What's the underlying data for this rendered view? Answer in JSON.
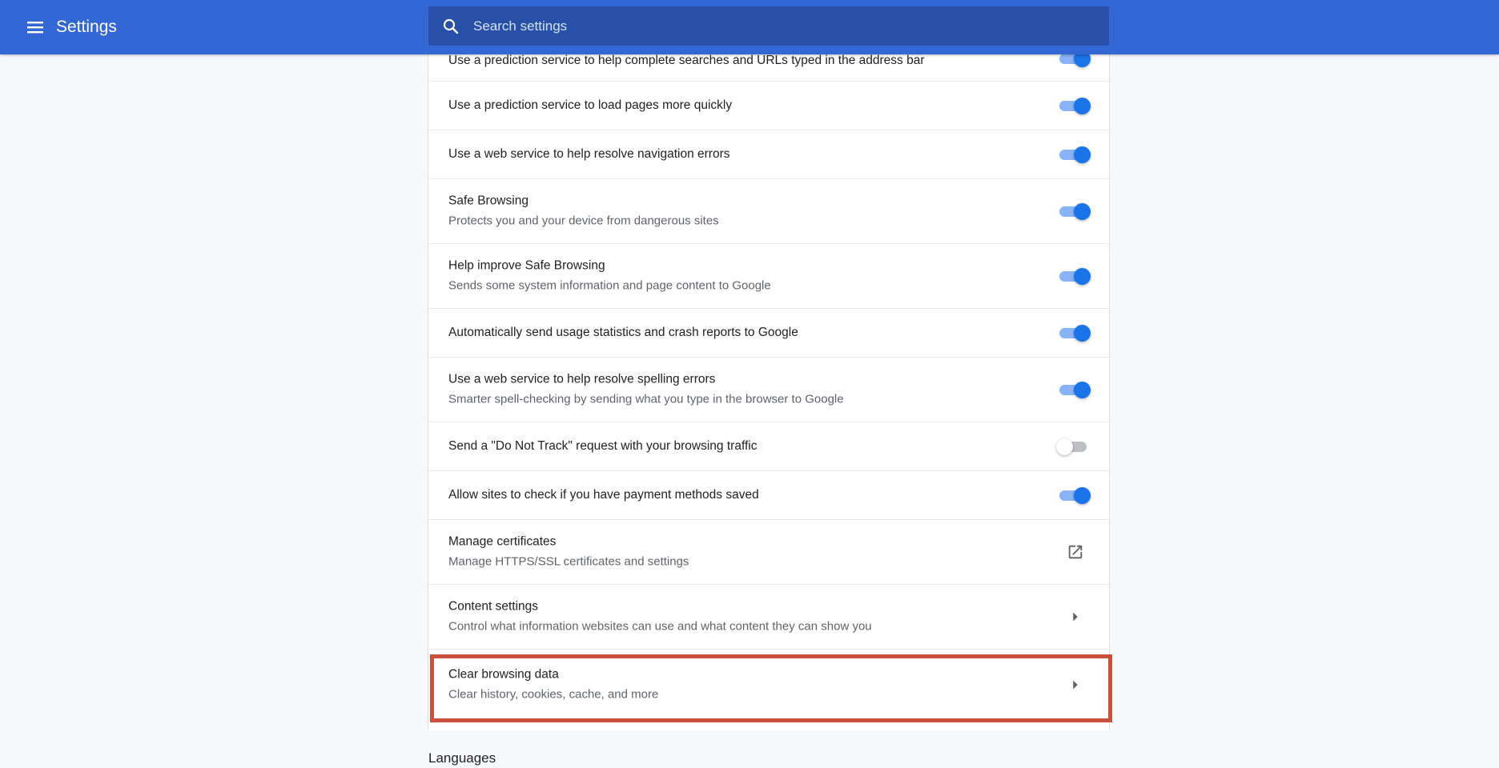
{
  "header": {
    "title": "Settings",
    "search_placeholder": "Search settings"
  },
  "rows": [
    {
      "title": "Use a prediction service to help complete searches and URLs typed in the address bar",
      "toggle": "on"
    },
    {
      "title": "Use a prediction service to load pages more quickly",
      "toggle": "on"
    },
    {
      "title": "Use a web service to help resolve navigation errors",
      "toggle": "on"
    },
    {
      "title": "Safe Browsing",
      "subtitle": "Protects you and your device from dangerous sites",
      "toggle": "on"
    },
    {
      "title": "Help improve Safe Browsing",
      "subtitle": "Sends some system information and page content to Google",
      "toggle": "on"
    },
    {
      "title": "Automatically send usage statistics and crash reports to Google",
      "toggle": "on"
    },
    {
      "title": "Use a web service to help resolve spelling errors",
      "subtitle": "Smarter spell-checking by sending what you type in the browser to Google",
      "toggle": "on"
    },
    {
      "title": "Send a \"Do Not Track\" request with your browsing traffic",
      "toggle": "off"
    },
    {
      "title": "Allow sites to check if you have payment methods saved",
      "toggle": "on"
    },
    {
      "title": "Manage certificates",
      "subtitle": "Manage HTTPS/SSL certificates and settings",
      "icon": "open-in-new-icon"
    },
    {
      "title": "Content settings",
      "subtitle": "Control what information websites can use and what content they can show you",
      "icon": "chevron-right-icon"
    },
    {
      "title": "Clear browsing data",
      "subtitle": "Clear history, cookies, cache, and more",
      "icon": "chevron-right-icon"
    }
  ],
  "next_section": {
    "title": "Languages"
  },
  "colors": {
    "header_bg": "#3367d6",
    "search_bg": "#2850a9",
    "toggle_on": "#1a73e8",
    "highlight_border": "#c9523b"
  }
}
